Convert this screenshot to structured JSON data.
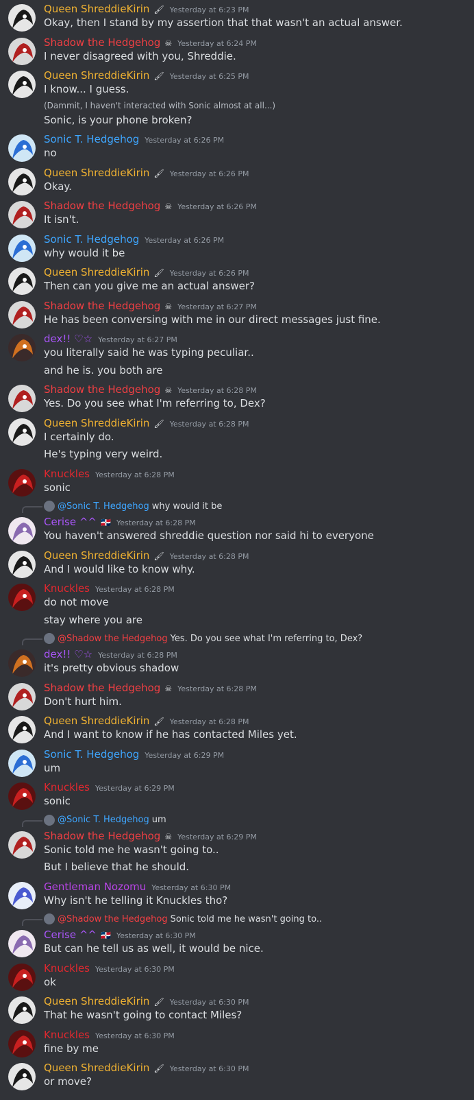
{
  "users": {
    "shreddie": {
      "name": "Queen ShreddieKirin",
      "color": "#f0b232",
      "badge": "🖌"
    },
    "shadow": {
      "name": "Shadow the Hedgehog",
      "color": "#f23f43",
      "badge": "☠"
    },
    "sonic": {
      "name": "Sonic T. Hedgehog",
      "color": "#3ea6ff",
      "badge": ""
    },
    "dex": {
      "name": "dex!! ♡☆",
      "color": "#a855f7",
      "badge": ""
    },
    "knuckles": {
      "name": "Knuckles",
      "color": "#e0282f",
      "badge": ""
    },
    "cerise": {
      "name": "Cerise ^^",
      "color": "#a855f7",
      "badge": "🇩🇴"
    },
    "nozomu": {
      "name": "Gentleman Nozomu",
      "color": "#b845e6",
      "badge": ""
    }
  },
  "messages": [
    {
      "user": "shreddie",
      "time": "Yesterday at 6:23 PM",
      "lines": [
        "Okay, then I stand by my assertion that that wasn't an actual answer."
      ]
    },
    {
      "user": "shadow",
      "time": "Yesterday at 6:24 PM",
      "lines": [
        "I never disagreed with you, Shreddie."
      ]
    },
    {
      "user": "shreddie",
      "time": "Yesterday at 6:25 PM",
      "lines": [
        "I know... I guess.",
        "(Dammit, I haven't interacted with Sonic almost at all...)",
        "Sonic, is your phone broken?"
      ]
    },
    {
      "user": "sonic",
      "time": "Yesterday at 6:26 PM",
      "lines": [
        "no"
      ]
    },
    {
      "user": "shreddie",
      "time": "Yesterday at 6:26 PM",
      "lines": [
        "Okay."
      ]
    },
    {
      "user": "shadow",
      "time": "Yesterday at 6:26 PM",
      "lines": [
        "It isn't."
      ]
    },
    {
      "user": "sonic",
      "time": "Yesterday at 6:26 PM",
      "lines": [
        "why would it be"
      ]
    },
    {
      "user": "shreddie",
      "time": "Yesterday at 6:26 PM",
      "lines": [
        "Then can you give me an actual answer?"
      ]
    },
    {
      "user": "shadow",
      "time": "Yesterday at 6:27 PM",
      "lines": [
        "He has been conversing with me in our direct messages just fine."
      ]
    },
    {
      "user": "dex",
      "time": "Yesterday at 6:27 PM",
      "lines": [
        "you literally said he was typing peculiar..",
        "and he is. you both are"
      ]
    },
    {
      "user": "shadow",
      "time": "Yesterday at 6:28 PM",
      "lines": [
        "Yes. Do you see what I'm referring to, Dex?"
      ]
    },
    {
      "user": "shreddie",
      "time": "Yesterday at 6:28 PM",
      "lines": [
        "I certainly do.",
        "He's typing very weird."
      ]
    },
    {
      "user": "knuckles",
      "time": "Yesterday at 6:28 PM",
      "lines": [
        "sonic"
      ]
    },
    {
      "user": "cerise",
      "time": "Yesterday at 6:28 PM",
      "reply": {
        "user": "@Sonic T. Hedgehog",
        "color": "#3ea6ff",
        "text": "why would it be"
      },
      "lines": [
        "You haven't answered shreddie question nor said hi to everyone"
      ]
    },
    {
      "user": "shreddie",
      "time": "Yesterday at 6:28 PM",
      "lines": [
        "And I would like to know why."
      ]
    },
    {
      "user": "knuckles",
      "time": "Yesterday at 6:28 PM",
      "lines": [
        "do not move",
        "stay where you are"
      ]
    },
    {
      "user": "dex",
      "time": "Yesterday at 6:28 PM",
      "reply": {
        "user": "@Shadow the Hedgehog",
        "color": "#f23f43",
        "text": "Yes. Do you see what I'm referring to, Dex?"
      },
      "lines": [
        "it's pretty obvious shadow"
      ]
    },
    {
      "user": "shadow",
      "time": "Yesterday at 6:28 PM",
      "lines": [
        "Don't hurt him."
      ]
    },
    {
      "user": "shreddie",
      "time": "Yesterday at 6:28 PM",
      "lines": [
        "And I want to know if he has contacted Miles yet."
      ]
    },
    {
      "user": "sonic",
      "time": "Yesterday at 6:29 PM",
      "lines": [
        "um"
      ]
    },
    {
      "user": "knuckles",
      "time": "Yesterday at 6:29 PM",
      "lines": [
        "sonic"
      ]
    },
    {
      "user": "shadow",
      "time": "Yesterday at 6:29 PM",
      "reply": {
        "user": "@Sonic T. Hedgehog",
        "color": "#3ea6ff",
        "text": "um"
      },
      "lines": [
        "Sonic told me he wasn't going to..",
        "But I believe that he should."
      ]
    },
    {
      "user": "nozomu",
      "time": "Yesterday at 6:30 PM",
      "lines": [
        "Why isn't he telling it Knuckles tho?"
      ]
    },
    {
      "user": "cerise",
      "time": "Yesterday at 6:30 PM",
      "reply": {
        "user": "@Shadow the Hedgehog",
        "color": "#f23f43",
        "text": "Sonic told me he wasn't going to.."
      },
      "lines": [
        "But can he tell us as well, it would be nice."
      ]
    },
    {
      "user": "knuckles",
      "time": "Yesterday at 6:30 PM",
      "lines": [
        "ok"
      ]
    },
    {
      "user": "shreddie",
      "time": "Yesterday at 6:30 PM",
      "lines": [
        "That he wasn't going to contact Miles?"
      ]
    },
    {
      "user": "knuckles",
      "time": "Yesterday at 6:30 PM",
      "lines": [
        "fine by me"
      ]
    },
    {
      "user": "shreddie",
      "time": "Yesterday at 6:30 PM",
      "lines": [
        "or move?"
      ]
    }
  ]
}
